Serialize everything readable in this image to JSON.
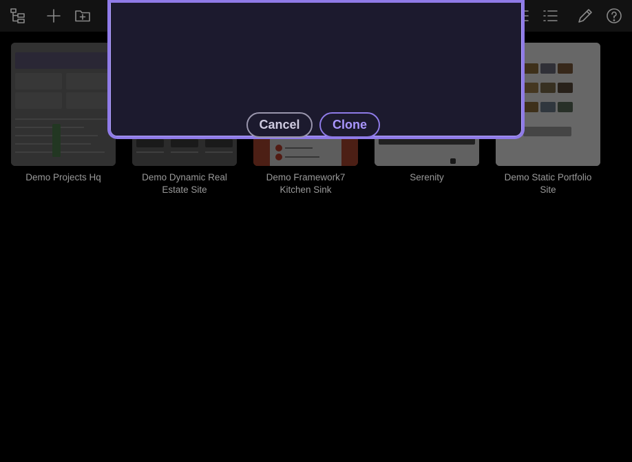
{
  "toolbar": {
    "left_icons": [
      "site-tree-icon",
      "plus-icon",
      "new-folder-icon"
    ],
    "right_icons": [
      "grid-view-icon",
      "list-view-icon",
      "edit-pencil-icon",
      "help-icon"
    ]
  },
  "projects": [
    {
      "title": "Demo Projects Hq"
    },
    {
      "title": "Demo Dynamic Real Estate Site"
    },
    {
      "title": "Demo Framework7 Kitchen Sink"
    },
    {
      "title": "Serenity"
    },
    {
      "title": "Demo Static Portfolio Site"
    }
  ],
  "dialog": {
    "cancel_label": "Cancel",
    "clone_label": "Clone"
  },
  "colors": {
    "accent": "#8f7be8",
    "dialog_bg": "#1c1a2e",
    "page_bg": "#000000"
  }
}
